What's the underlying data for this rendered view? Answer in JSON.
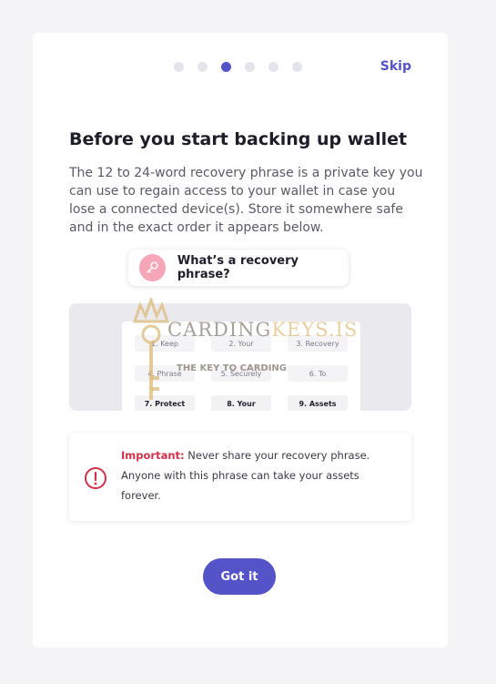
{
  "header": {
    "steps_total": 6,
    "active_step": 3,
    "skip_label": "Skip",
    "accent_color": "#5454c8"
  },
  "title": "Before you start backing up wallet",
  "description": "The 12 to 24-word recovery phrase is a private key you can use to regain access to your wallet in case you lose a connected device(s). Store it somewhere safe and in the exact order it appears below.",
  "phrase_link": {
    "label": "What’s a recovery phrase?",
    "icon": "key-icon"
  },
  "illustration": {
    "words": [
      {
        "label": "1. Keep",
        "bold": false
      },
      {
        "label": "2. Your",
        "bold": false
      },
      {
        "label": "3. Recovery",
        "bold": false
      },
      {
        "label": "4. Phrase",
        "bold": false
      },
      {
        "label": "5. Securely",
        "bold": false
      },
      {
        "label": "6. To",
        "bold": false
      },
      {
        "label": "7. Protect",
        "bold": true
      },
      {
        "label": "8. Your",
        "bold": true
      },
      {
        "label": "9. Assets",
        "bold": true
      }
    ]
  },
  "watermark": {
    "logo_part1": "CARDING",
    "logo_part2": "KEYS.IS",
    "tagline": "THE KEY TO CARDING"
  },
  "warning": {
    "icon": "alert-circle-icon",
    "important_label": "Important:",
    "text": " Never share your recovery phrase. Anyone with this phrase can take your assets forever.",
    "color": "#d1304a"
  },
  "button": {
    "label": "Got it"
  }
}
